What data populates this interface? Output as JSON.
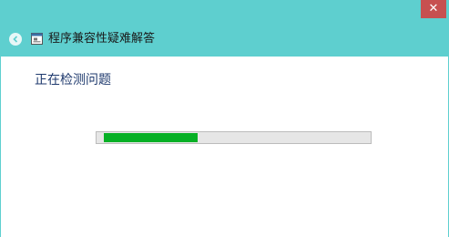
{
  "window": {
    "title": "程序兼容性疑难解答",
    "close_label": "✕",
    "titlebar_color": "#5ecfcf",
    "close_color": "#c75050"
  },
  "main": {
    "heading": "正在检测问题",
    "progress_fraction": 0.36,
    "progress_color": "#06b025"
  },
  "icons": {
    "back": "back-arrow-icon",
    "app": "troubleshooter-app-icon",
    "close": "close-icon"
  }
}
